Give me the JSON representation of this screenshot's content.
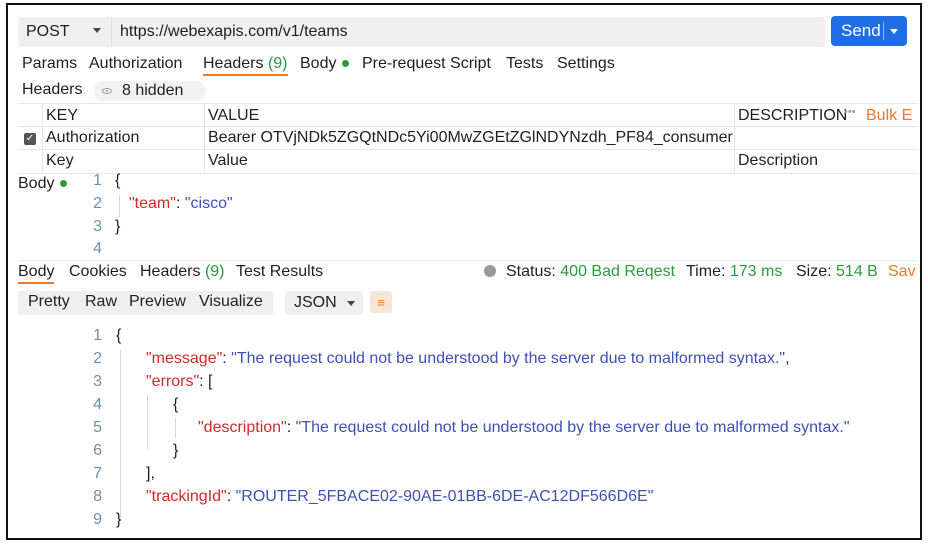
{
  "request": {
    "method": "POST",
    "url": "https://webexapis.com/v1/teams",
    "send_label": "Send"
  },
  "request_tabs": {
    "params": "Params",
    "authorization": "Authorization",
    "headers": "Headers",
    "headers_count": "(9)",
    "body": "Body",
    "pre_request": "Pre-request Script",
    "tests": "Tests",
    "settings": "Settings"
  },
  "headers_section": {
    "title": "Headers",
    "hidden": "8 hidden"
  },
  "headers_table": {
    "col_key": "KEY",
    "col_value": "VALUE",
    "col_description": "DESCRIPTION",
    "more": "•••",
    "bulk_edit": "Bulk E",
    "row": {
      "key": "Authorization",
      "value": "Bearer OTVjNDk5ZGQtNDc5Yi00MwZGEtZGlNDYNzdh_PF84_consumer",
      "checked": true
    },
    "placeholder": {
      "key": "Key",
      "value": "Value",
      "description": "Description"
    }
  },
  "request_body": {
    "label": "Body",
    "lines": [
      {
        "n": "1",
        "text": "{"
      },
      {
        "n": "2",
        "key": "\"team\"",
        "sep": ": ",
        "val": "\"cisco\""
      },
      {
        "n": "3",
        "text": "}"
      },
      {
        "n": "4",
        "text": ""
      }
    ]
  },
  "response_tabs": {
    "body": "Body",
    "cookies": "Cookies",
    "headers": "Headers",
    "headers_count": "(9)",
    "test_results": "Test Results"
  },
  "response_status": {
    "status_label": "Status:",
    "status_value": "400 Bad Reqest",
    "time_label": "Time:",
    "time_value": "173 ms",
    "size_label": "Size:",
    "size_value": "514 B",
    "save": "Sav"
  },
  "view_modes": {
    "pretty": "Pretty",
    "raw": "Raw",
    "preview": "Preview",
    "visualize": "Visualize",
    "format": "JSON"
  },
  "response_body": {
    "lines": [
      {
        "n": "1",
        "text": "{"
      },
      {
        "n": "2",
        "key": "\"message\"",
        "sep": ": ",
        "val": "\"The request could not be understood by the server due to malformed syntax.\"",
        "tail": ","
      },
      {
        "n": "3",
        "key": "\"errors\"",
        "sep": ": ",
        "tail": "["
      },
      {
        "n": "4",
        "text": "{"
      },
      {
        "n": "5",
        "key": "\"description\"",
        "sep": ": ",
        "val": "\"The request could not be understood by the server due to malformed syntax.\""
      },
      {
        "n": "6",
        "text": "}"
      },
      {
        "n": "7",
        "text": "],"
      },
      {
        "n": "8",
        "key": "\"trackingId\"",
        "sep": ": ",
        "val": "\"ROUTER_5FBACE02-90AE-01BB-6DE-AC12DF566D6E\""
      },
      {
        "n": "9",
        "text": "}"
      }
    ]
  },
  "colors": {
    "accent": "#e8792b",
    "send": "#1f6ee6",
    "status_ok": "#2a9b3a",
    "json_key": "#d12a2a",
    "json_string": "#3f4fb5"
  }
}
